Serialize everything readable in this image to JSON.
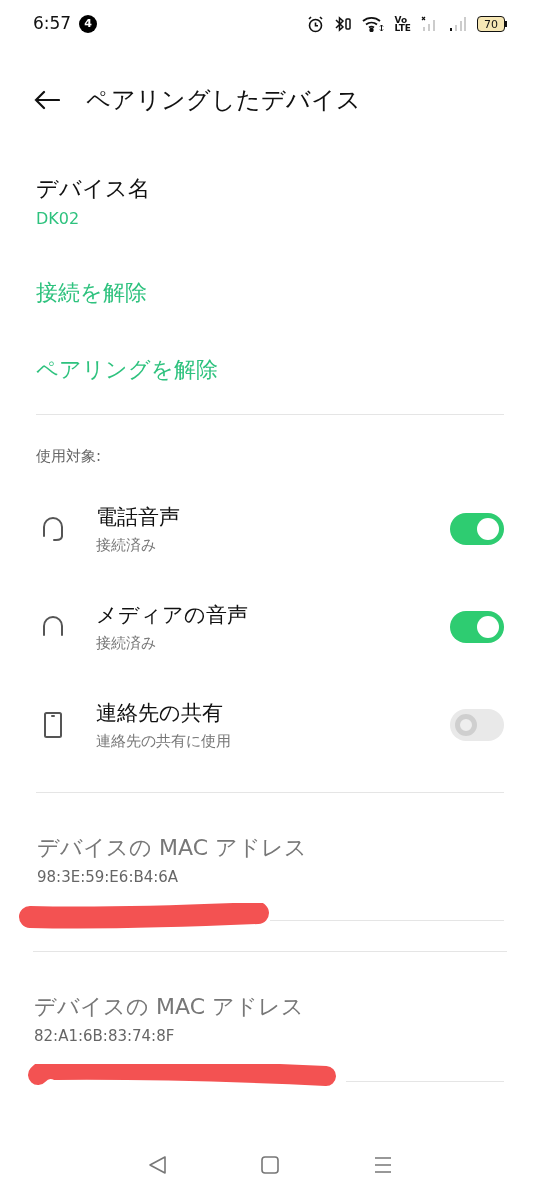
{
  "status_bar": {
    "time": "6:57",
    "notification_count": "4",
    "volte": [
      "Vo",
      "LTE"
    ],
    "battery": "70"
  },
  "header": {
    "title": "ペアリングしたデバイス"
  },
  "device_name": {
    "label": "デバイス名",
    "value": "DK02"
  },
  "actions": [
    "接続を解除",
    "ペアリングを解除"
  ],
  "section_label": "使用対象:",
  "profiles": [
    {
      "kind": "headset",
      "title": "電話音声",
      "subtitle": "接続済み",
      "on": true
    },
    {
      "kind": "headphones",
      "title": "メディアの音声",
      "subtitle": "接続済み",
      "on": true
    },
    {
      "kind": "phone",
      "title": "連絡先の共有",
      "subtitle": "連絡先の共有に使用",
      "on": false
    }
  ],
  "mac_addresses": [
    {
      "label": "デバイスの MAC アドレス",
      "value": "98:3E:59:E6:B4:6A"
    },
    {
      "label": "デバイスの MAC アドレス",
      "value": "82:A1:6B:83:74:8F"
    }
  ]
}
